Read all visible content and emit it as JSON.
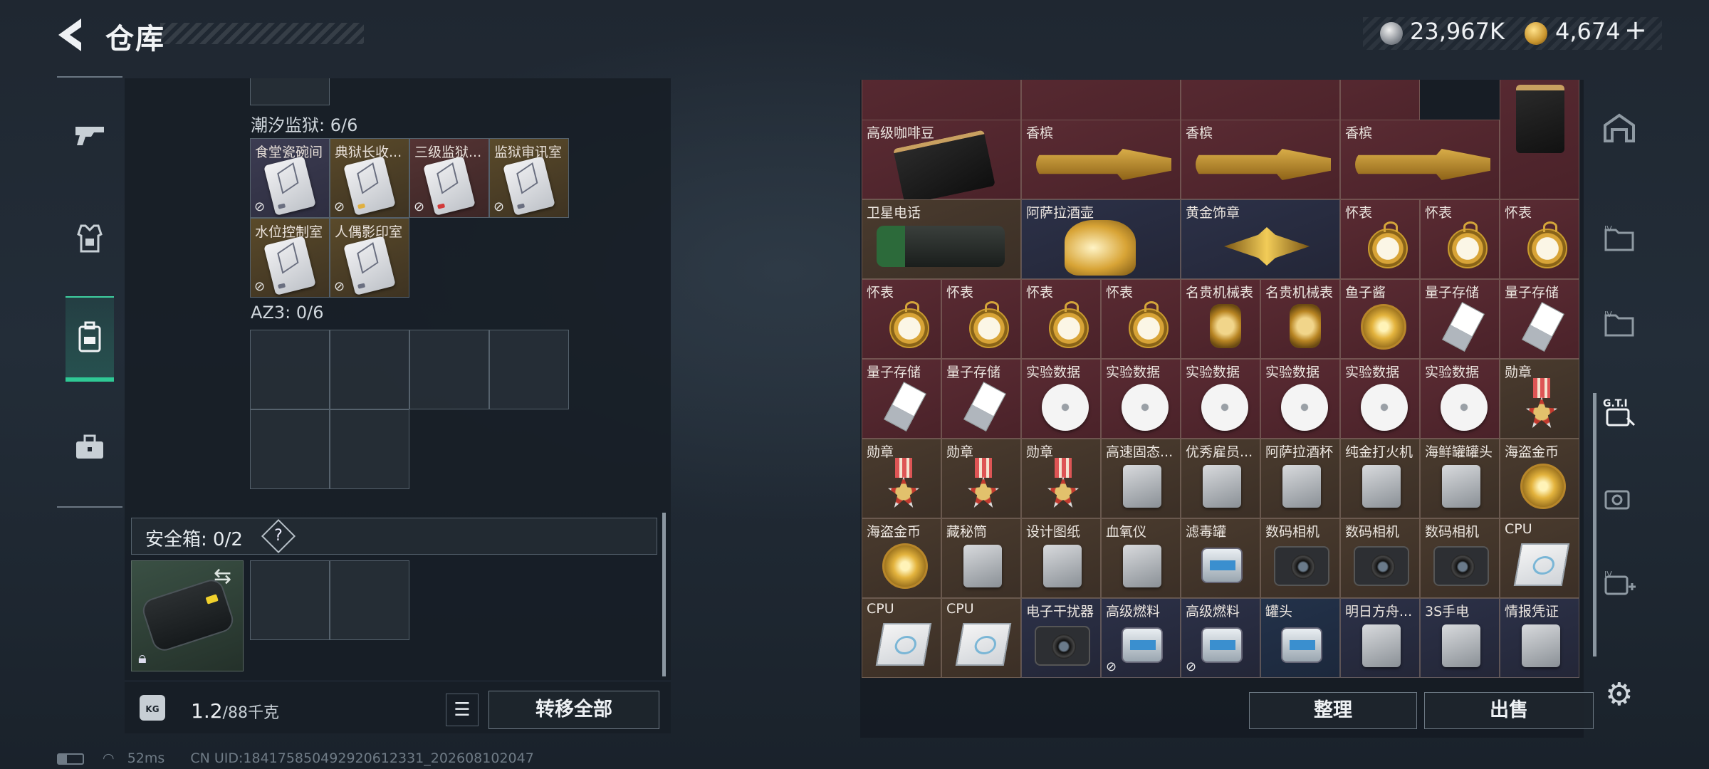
{
  "header": {
    "title": "仓库",
    "currency_silver": "23,967K",
    "currency_gold": "4,674",
    "plus": "+"
  },
  "left_rail": {
    "items": [
      {
        "name": "weapons-tab",
        "icon": "gun-icon"
      },
      {
        "name": "equipment-tab",
        "icon": "armor-icon"
      },
      {
        "name": "backpack-tab",
        "icon": "backpack-icon",
        "active": true
      },
      {
        "name": "briefcase-tab",
        "icon": "briefcase-icon"
      }
    ]
  },
  "stash": {
    "section1_title": "潮汐监狱: 6/6",
    "section1_keys": [
      {
        "label": "食堂瓷碗间",
        "theme": "purple",
        "accent": "#6a6f80"
      },
      {
        "label": "典狱长收...",
        "theme": "gold",
        "accent": "#e0b040"
      },
      {
        "label": "三级监狱...",
        "theme": "red",
        "accent": "#d23a3a"
      },
      {
        "label": "监狱审讯室",
        "theme": "gold",
        "accent": "#6a6f80"
      },
      {
        "label": "水位控制室",
        "theme": "gold",
        "accent": "#6a6f80"
      },
      {
        "label": "人偶影印室",
        "theme": "gold",
        "accent": "#6a6f80"
      }
    ],
    "section2_title": "AZ3: 0/6",
    "safe_box_label": "安全箱: 0/2",
    "safe_help": "?",
    "weight_value": "1.2",
    "weight_max": "/88千克",
    "kg_label": "KG",
    "transfer_all": "转移全部"
  },
  "grid": {
    "items": [
      {
        "label": "高级咖啡豆",
        "bg": "red",
        "icon": "coffee-bag-icon"
      },
      {
        "label": "香槟",
        "bg": "red",
        "icon": "champagne-icon"
      },
      {
        "label": "香槟",
        "bg": "red",
        "icon": "champagne-icon"
      },
      {
        "label": "香槟",
        "bg": "red",
        "icon": "champagne-icon"
      },
      {
        "label": "卫星电话",
        "bg": "gold",
        "icon": "satellite-phone-icon"
      },
      {
        "label": "阿萨拉酒壶",
        "bg": "purple",
        "icon": "ewer-icon"
      },
      {
        "label": "黄金饰章",
        "bg": "purple",
        "icon": "gold-emblem-icon"
      },
      {
        "label": "怀表",
        "bg": "red",
        "icon": "pocket-watch-icon"
      },
      {
        "label": "怀表",
        "bg": "red",
        "icon": "pocket-watch-icon"
      },
      {
        "label": "怀表",
        "bg": "red",
        "icon": "pocket-watch-icon"
      },
      {
        "label": "怀表",
        "bg": "red",
        "icon": "pocket-watch-icon"
      },
      {
        "label": "怀表",
        "bg": "red",
        "icon": "pocket-watch-icon"
      },
      {
        "label": "怀表",
        "bg": "red",
        "icon": "pocket-watch-icon"
      },
      {
        "label": "怀表",
        "bg": "red",
        "icon": "pocket-watch-icon"
      },
      {
        "label": "名贵机械表",
        "bg": "red",
        "icon": "wristwatch-icon"
      },
      {
        "label": "名贵机械表",
        "bg": "red",
        "icon": "wristwatch-icon"
      },
      {
        "label": "鱼子酱",
        "bg": "red",
        "icon": "caviar-icon"
      },
      {
        "label": "量子存储",
        "bg": "red",
        "icon": "usb-drive-icon"
      },
      {
        "label": "量子存储",
        "bg": "red",
        "icon": "usb-drive-icon"
      },
      {
        "label": "量子存储",
        "bg": "red",
        "icon": "usb-drive-icon"
      },
      {
        "label": "量子存储",
        "bg": "red",
        "icon": "usb-drive-icon"
      },
      {
        "label": "实验数据",
        "bg": "red",
        "icon": "disc-icon"
      },
      {
        "label": "实验数据",
        "bg": "red",
        "icon": "disc-icon"
      },
      {
        "label": "实验数据",
        "bg": "red",
        "icon": "disc-icon"
      },
      {
        "label": "实验数据",
        "bg": "red",
        "icon": "disc-icon"
      },
      {
        "label": "实验数据",
        "bg": "red",
        "icon": "disc-icon"
      },
      {
        "label": "实验数据",
        "bg": "red",
        "icon": "disc-icon"
      },
      {
        "label": "勋章",
        "bg": "gold",
        "icon": "medal-icon"
      },
      {
        "label": "勋章",
        "bg": "gold",
        "icon": "medal-icon"
      },
      {
        "label": "勋章",
        "bg": "gold",
        "icon": "medal-icon"
      },
      {
        "label": "勋章",
        "bg": "gold",
        "icon": "medal-icon"
      },
      {
        "label": "高速固态...",
        "bg": "gold",
        "icon": "ssd-icon"
      },
      {
        "label": "优秀雇员...",
        "bg": "gold",
        "icon": "trophy-icon"
      },
      {
        "label": "阿萨拉酒杯",
        "bg": "gold",
        "icon": "cup-icon"
      },
      {
        "label": "纯金打火机",
        "bg": "gold",
        "icon": "lighter-icon"
      },
      {
        "label": "海鲜罐罐头",
        "bg": "gold",
        "icon": "canned-seafood-icon"
      },
      {
        "label": "海盗金币",
        "bg": "gold",
        "icon": "gold-coin-icon"
      },
      {
        "label": "海盗金币",
        "bg": "gold",
        "icon": "gold-coin-icon"
      },
      {
        "label": "藏秘筒",
        "bg": "gold",
        "icon": "cryptex-icon"
      },
      {
        "label": "设计图纸",
        "bg": "gold",
        "icon": "blueprint-icon"
      },
      {
        "label": "血氧仪",
        "bg": "gold",
        "icon": "oximeter-icon"
      },
      {
        "label": "滤毒罐",
        "bg": "gold",
        "icon": "filter-canister-icon"
      },
      {
        "label": "数码相机",
        "bg": "gold",
        "icon": "camera-icon"
      },
      {
        "label": "数码相机",
        "bg": "gold",
        "icon": "camera-icon"
      },
      {
        "label": "数码相机",
        "bg": "gold",
        "icon": "camera-icon"
      },
      {
        "label": "CPU",
        "bg": "gold",
        "icon": "cpu-icon"
      },
      {
        "label": "CPU",
        "bg": "gold",
        "icon": "cpu-icon"
      },
      {
        "label": "CPU",
        "bg": "gold",
        "icon": "cpu-icon"
      },
      {
        "label": "电子干扰器",
        "bg": "purple",
        "icon": "jammer-icon"
      },
      {
        "label": "高级燃料",
        "bg": "purple",
        "icon": "fuel-can-icon"
      },
      {
        "label": "高级燃料",
        "bg": "purple",
        "icon": "fuel-can-icon"
      },
      {
        "label": "罐头",
        "bg": "blue",
        "icon": "tin-can-icon"
      },
      {
        "label": "明日方舟...",
        "bg": "purple",
        "icon": "album-icon"
      },
      {
        "label": "3S手电",
        "bg": "purple",
        "icon": "flashlight-icon"
      },
      {
        "label": "情报凭证",
        "bg": "purple",
        "icon": "intel-card-icon"
      }
    ]
  },
  "actions": {
    "sort": "整理",
    "sell": "出售"
  },
  "status": {
    "ping": "52ms",
    "uid": "CN UID:18417585049292061​2331_202608102047"
  }
}
